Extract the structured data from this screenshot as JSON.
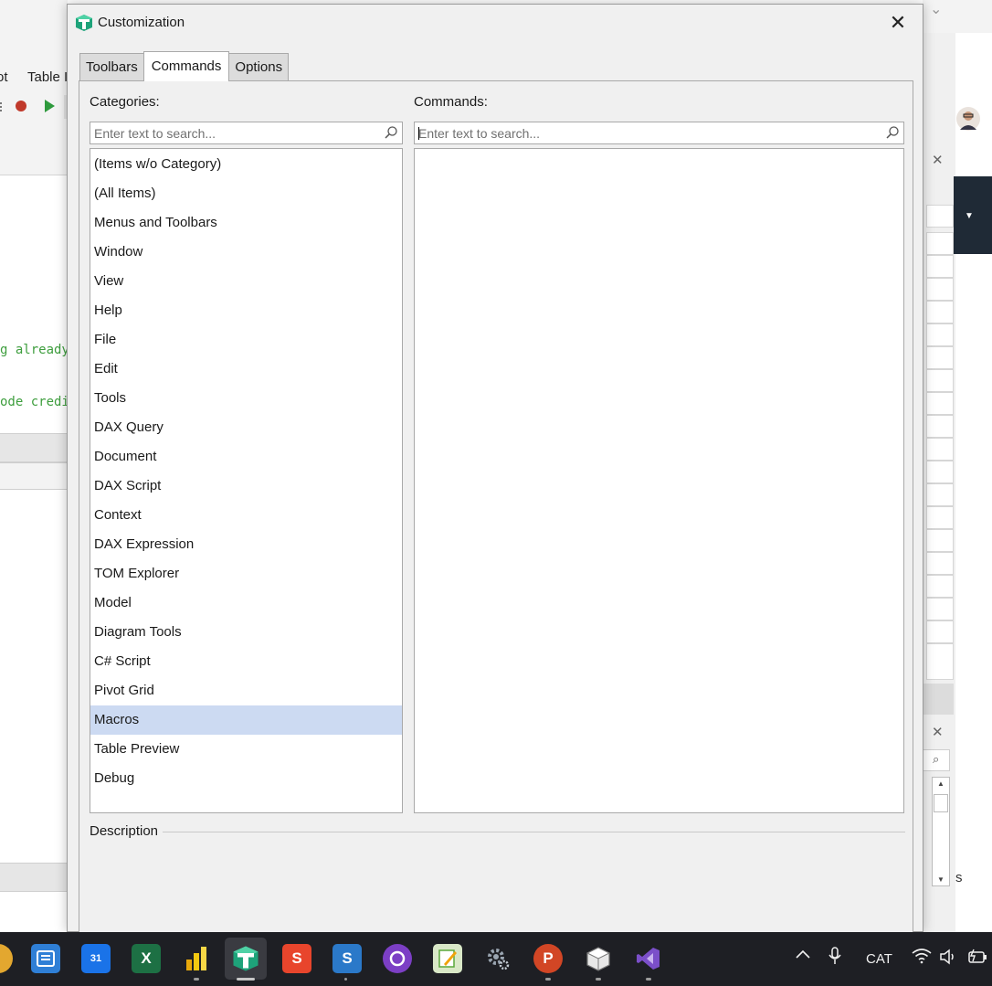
{
  "background_app": {
    "menu_fragment_1": "ot",
    "menu_fragment_2": "Table I",
    "code_line_1": "g already",
    "code_line_2": "ode credi",
    "right_panel_text": "s"
  },
  "dialog": {
    "title": "Customization",
    "close_glyph": "✕",
    "tabs": [
      {
        "label": "Toolbars",
        "active": false
      },
      {
        "label": "Commands",
        "active": true
      },
      {
        "label": "Options",
        "active": false
      }
    ],
    "categories": {
      "label": "Categories:",
      "search_placeholder": "Enter text to search...",
      "items": [
        "(Items w/o Category)",
        "(All Items)",
        "Menus and Toolbars",
        "Window",
        "View",
        "Help",
        "File",
        "Edit",
        "Tools",
        "DAX Query",
        "Document",
        "DAX Script",
        "Context",
        "DAX Expression",
        "TOM Explorer",
        "Model",
        "Diagram Tools",
        "C# Script",
        "Pivot Grid",
        "Macros",
        "Table Preview",
        "Debug"
      ],
      "selected": "Macros"
    },
    "commands": {
      "label": "Commands:",
      "search_placeholder": "Enter text to search...",
      "items": []
    },
    "description_label": "Description"
  },
  "taskbar": {
    "apps": [
      {
        "name": "file-explorer",
        "color": "#2f7fd6"
      },
      {
        "name": "calendar",
        "label": "31",
        "color": "#1a73e8"
      },
      {
        "name": "excel",
        "label": "X",
        "color": "#1d7044"
      },
      {
        "name": "power-bi",
        "color": "#f2c811"
      },
      {
        "name": "tabular-editor",
        "label": "T",
        "color": "#1ea37a"
      },
      {
        "name": "s-red-app",
        "label": "S",
        "color": "#e8452c"
      },
      {
        "name": "s-blue-app",
        "label": "S",
        "color": "#2b79c9"
      },
      {
        "name": "github-desktop",
        "color": "#7c3fc5"
      },
      {
        "name": "notepad-app",
        "color": "#5aa83c"
      },
      {
        "name": "settings",
        "color": "#9aa5b1"
      },
      {
        "name": "powerpoint",
        "label": "P",
        "color": "#d24625"
      },
      {
        "name": "package-app",
        "color": "#cfcfcf"
      },
      {
        "name": "visual-studio",
        "color": "#7b4fc9"
      }
    ],
    "language": "CAT",
    "colors": {
      "taskbar_bg": "#1e1f24",
      "selection": "#ccdaf2"
    }
  }
}
